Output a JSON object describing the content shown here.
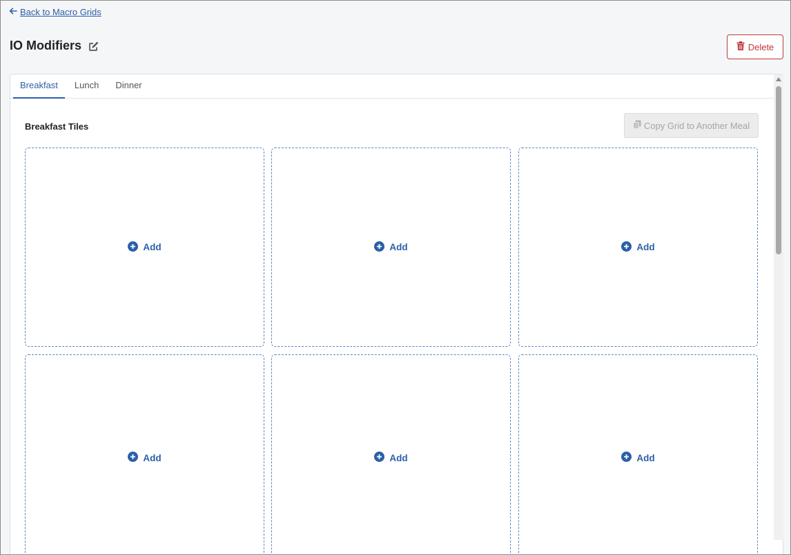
{
  "nav": {
    "back_label": "Back to Macro Grids"
  },
  "page": {
    "title": "IO Modifiers",
    "delete_label": "Delete"
  },
  "tabs": [
    {
      "label": "Breakfast",
      "active": true
    },
    {
      "label": "Lunch",
      "active": false
    },
    {
      "label": "Dinner",
      "active": false
    }
  ],
  "section": {
    "title": "Breakfast Tiles",
    "copy_label": "Copy Grid to Another Meal"
  },
  "tiles": [
    {
      "add_label": "Add"
    },
    {
      "add_label": "Add"
    },
    {
      "add_label": "Add"
    },
    {
      "add_label": "Add"
    },
    {
      "add_label": "Add"
    },
    {
      "add_label": "Add"
    }
  ],
  "colors": {
    "accent": "#2b5fa8",
    "danger": "#c0363a",
    "tile_border": "#5b84c4",
    "disabled_text": "#a5a5a5"
  }
}
